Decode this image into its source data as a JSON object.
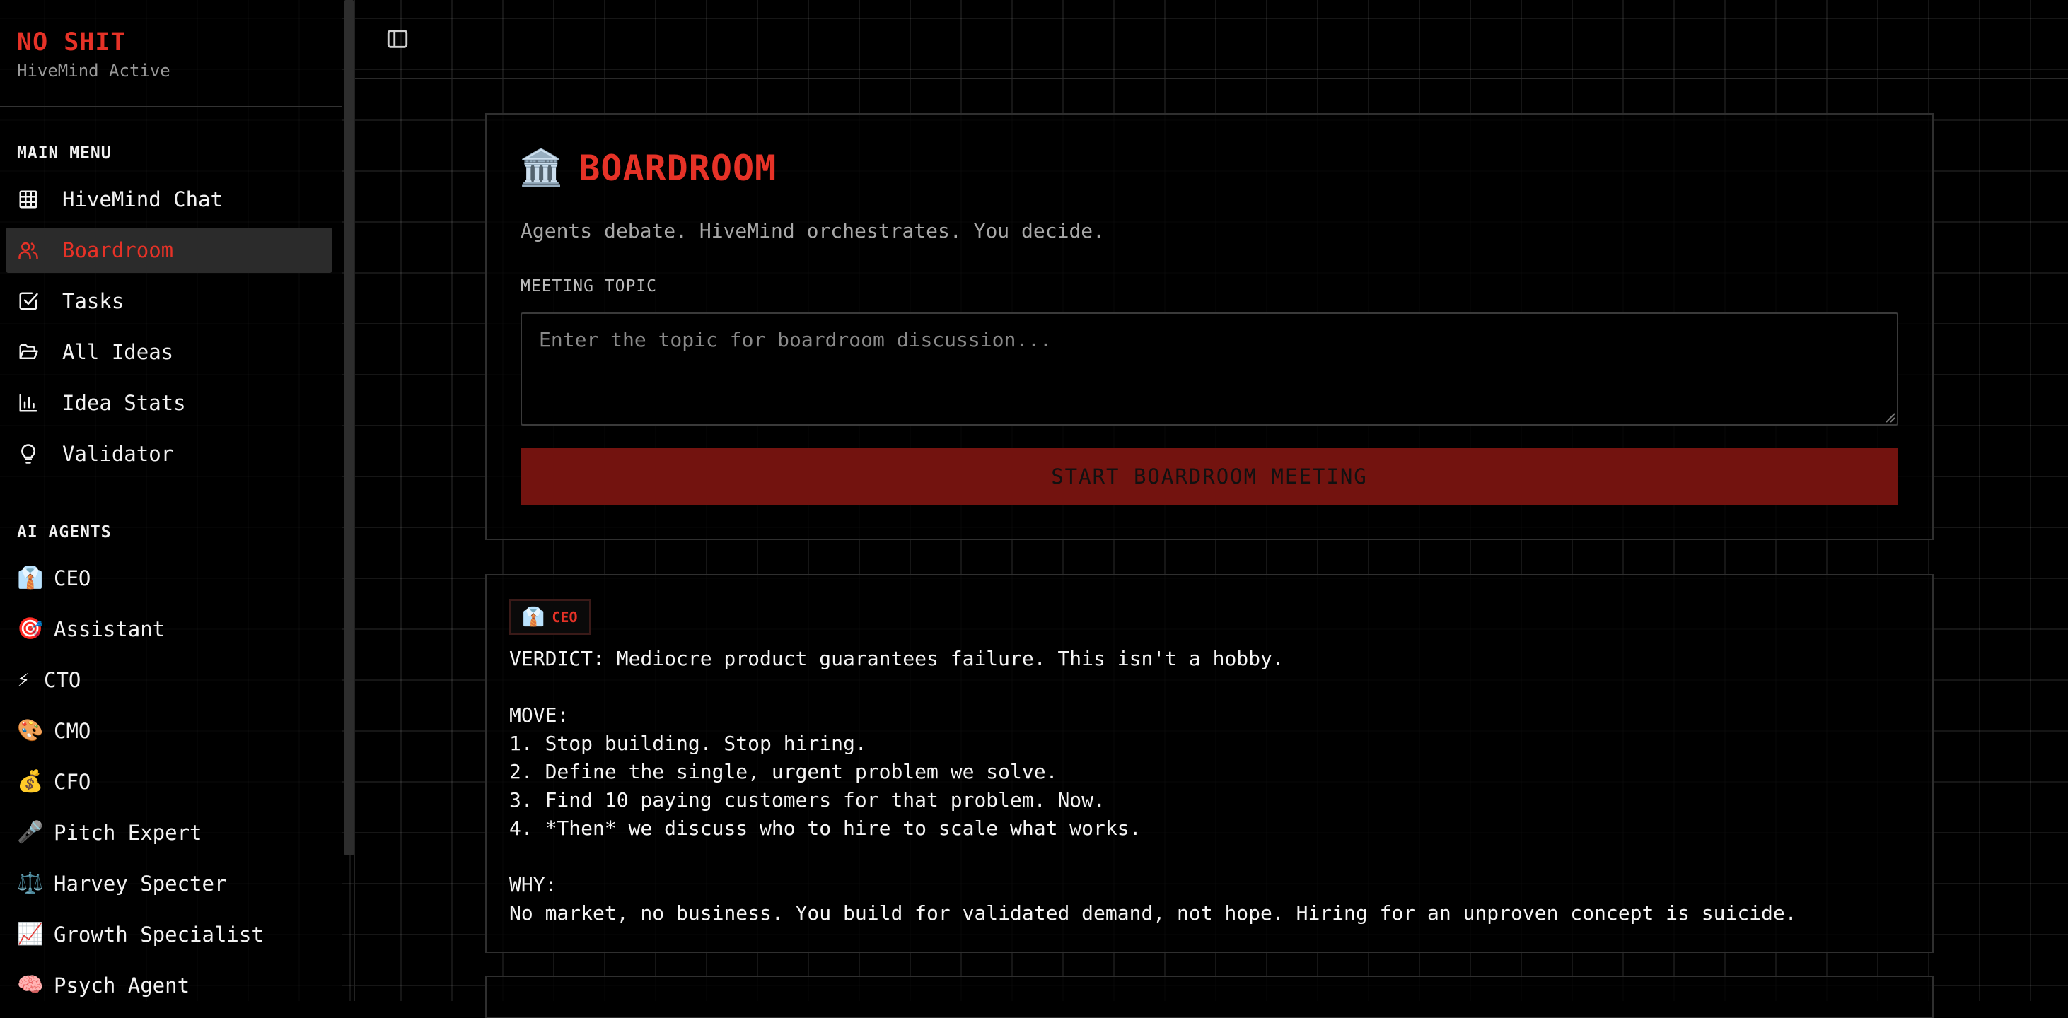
{
  "brand": {
    "title": "NO SHIT",
    "subtitle": "HiveMind Active"
  },
  "sidebar": {
    "main_menu_label": "MAIN MENU",
    "main_menu": [
      {
        "label": "HiveMind Chat",
        "icon": "grid-icon",
        "active": false
      },
      {
        "label": "Boardroom",
        "icon": "users-icon",
        "active": true
      },
      {
        "label": "Tasks",
        "icon": "checkbox-icon",
        "active": false
      },
      {
        "label": "All Ideas",
        "icon": "folder-open-icon",
        "active": false
      },
      {
        "label": "Idea Stats",
        "icon": "bar-chart-icon",
        "active": false
      },
      {
        "label": "Validator",
        "icon": "lightbulb-icon",
        "active": false
      }
    ],
    "agents_label": "AI AGENTS",
    "agents": [
      {
        "emoji": "👔",
        "label": "CEO"
      },
      {
        "emoji": "🎯",
        "label": "Assistant"
      },
      {
        "emoji": "⚡",
        "label": "CTO"
      },
      {
        "emoji": "🎨",
        "label": "CMO"
      },
      {
        "emoji": "💰",
        "label": "CFO"
      },
      {
        "emoji": "🎤",
        "label": "Pitch Expert"
      },
      {
        "emoji": "⚖️",
        "label": "Harvey Specter"
      },
      {
        "emoji": "📈",
        "label": "Growth Specialist"
      },
      {
        "emoji": "🧠",
        "label": "Psych Agent"
      }
    ]
  },
  "boardroom": {
    "emoji": "🏛️",
    "title": "BOARDROOM",
    "subtitle": "Agents debate. HiveMind orchestrates. You decide.",
    "topic_label": "MEETING TOPIC",
    "topic_placeholder": "Enter the topic for boardroom discussion...",
    "topic_value": "",
    "start_button": "START BOARDROOM MEETING"
  },
  "messages": [
    {
      "agent_emoji": "👔",
      "agent": "CEO",
      "text": "VERDICT: Mediocre product guarantees failure. This isn't a hobby.\n\nMOVE:\n1. Stop building. Stop hiring.\n2. Define the single, urgent problem we solve.\n3. Find 10 paying customers for that problem. Now.\n4. *Then* we discuss who to hire to scale what works.\n\nWHY:\nNo market, no business. You build for validated demand, not hope. Hiring for an unproven concept is suicide."
    }
  ],
  "colors": {
    "accent": "#e63227",
    "button_bg": "#73130f",
    "background": "#000000"
  }
}
